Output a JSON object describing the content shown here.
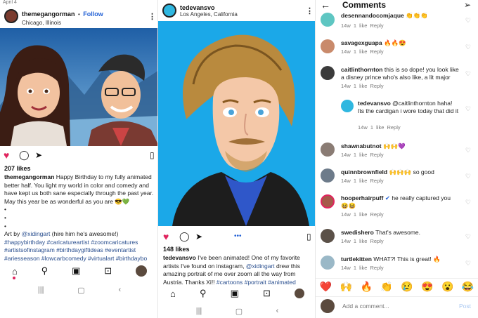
{
  "panel1": {
    "date": "April 4",
    "username": "themegangorman",
    "follow_sep": "•",
    "follow": "Follow",
    "location": "Chicago, Illinois",
    "likes": "207 likes",
    "caption_user": "themegangorman",
    "caption_text": "Happy Birthday to my fully animated better half. You light my world in color and comedy and have kept us both sane especially through the past year. May this year be as wonderful as you are 😎💚",
    "bullets": [
      "•",
      "•",
      "•"
    ],
    "credit_pre": "Art by ",
    "credit_mention": "@xidingart",
    "credit_post": " (hire him he's awesome!)",
    "hashtags": "#happybirthday #caricatureartist #zoomcaricatures #artistsofinstagram #birthdaygiftideas #eventartist #ariesseason #lowcarbcomedy #virtualart #birthdaybo"
  },
  "panel2": {
    "username": "tedevansvo",
    "location": "Los Angeles, California",
    "likes": "148 likes",
    "caption_user": "tedevansvo",
    "caption_text": "I've been animated! One of my favorite artists I've found on instagram, ",
    "caption_mention": "@xidingart",
    "caption_text2": " drew this amazing portrait of me over zoom all the way from Austria. Thanks Xi!! ",
    "caption_tags": "#cartoons #portrait #animated"
  },
  "panel3": {
    "title": "Comments",
    "comments": [
      {
        "user": "desennandocomjaque",
        "text": "👏👏👏",
        "time": "14w",
        "likes": "1 like",
        "reply": "Reply",
        "avatar_color": "#5ec6c2"
      },
      {
        "user": "savagexguapa",
        "text": "🔥🔥😍",
        "time": "14w",
        "likes": "1 like",
        "reply": "Reply",
        "avatar_color": "#c98a6b"
      },
      {
        "user": "caitlinthornton",
        "text": "this is so dope! you look like a disney prince who's also like, a lit major",
        "time": "14w",
        "likes": "1 like",
        "reply": "Reply",
        "avatar_color": "#3b3b3b"
      },
      {
        "user": "tedevansvo",
        "text": "@caitlinthornton haha! Its the cardigan i wore today that did it",
        "time": "14w",
        "likes": "1 like",
        "reply": "Reply",
        "avatar_color": "#2fb7e0"
      },
      {
        "user": "shawnabutnot",
        "text": "🙌🙌💜",
        "time": "14w",
        "likes": "1 like",
        "reply": "Reply",
        "avatar_color": "#8a7c74"
      },
      {
        "user": "quinnbrownfield",
        "text": "🙌🙌🙌 so good",
        "time": "14w",
        "likes": "1 like",
        "reply": "Reply",
        "avatar_color": "#6d7b8a"
      },
      {
        "user": "hooperhairpuff",
        "verified": "✔",
        "text": "he really captured you 😆😆",
        "time": "14w",
        "likes": "1 like",
        "reply": "Reply",
        "avatar_color": "#a55a4a"
      },
      {
        "user": "swedishero",
        "text": "That's awesome.",
        "time": "14w",
        "likes": "1 like",
        "reply": "Reply",
        "avatar_color": "#5b5148"
      },
      {
        "user": "turtlekitten",
        "text": "WHAT?! This is great! 🔥",
        "time": "14w",
        "likes": "1 like",
        "reply": "Reply",
        "avatar_color": "#9ab8c7"
      }
    ],
    "emojis": [
      "❤️",
      "🙌",
      "🔥",
      "👏",
      "😢",
      "😍",
      "😮",
      "😂"
    ],
    "add_placeholder": "Add a comment...",
    "post_label": "Post"
  },
  "colors": {
    "link": "#2563d6",
    "hashtag": "#2a4f8f",
    "meta": "#777777",
    "heart_red": "#e0245e",
    "portrait_bg": "#1ba8e8"
  },
  "icons": [
    "back-arrow-icon",
    "send-icon",
    "heart-icon",
    "comment-icon",
    "share-icon",
    "save-icon",
    "home-icon",
    "search-icon",
    "reels-icon",
    "shop-icon",
    "more-dots-icon"
  ]
}
